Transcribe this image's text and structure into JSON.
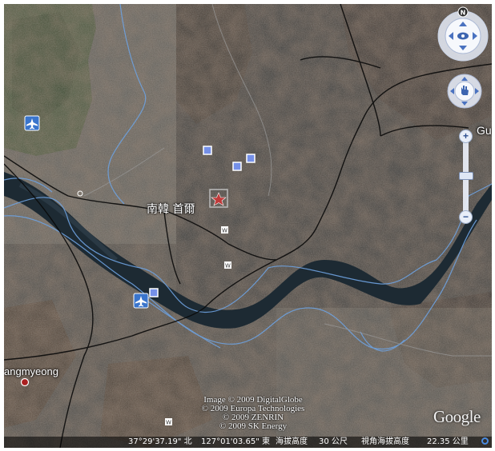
{
  "map": {
    "place_labels": {
      "seoul_cjk": "南韓 首爾",
      "gwangmyeong": "angmyeong",
      "right_edge": "Gu"
    },
    "north_label": "N",
    "road_marker_glyph": "W",
    "copyright_lines": [
      "Image © 2009 DigitalGlobe",
      "© 2009 Europa Technologies",
      "© 2009 ZENRIN",
      "© 2009 SK Energy"
    ],
    "logo_text": "Google",
    "status": {
      "latitude": "37°29'37.19\" 北",
      "longitude": "127°01'03.65\" 東",
      "elevation_label": "海拔高度",
      "elevation_value": "30 公尺",
      "eye_alt_label": "視角海拔高度",
      "eye_alt_value": "22.35 公里"
    },
    "controls": {
      "zoom_in": "+",
      "zoom_out": "−"
    },
    "icons": [
      "airport-icon",
      "photo-icon",
      "road-marker-icon",
      "place-marker-icon",
      "look-joystick-icon",
      "move-joystick-icon",
      "compass-icon"
    ]
  }
}
